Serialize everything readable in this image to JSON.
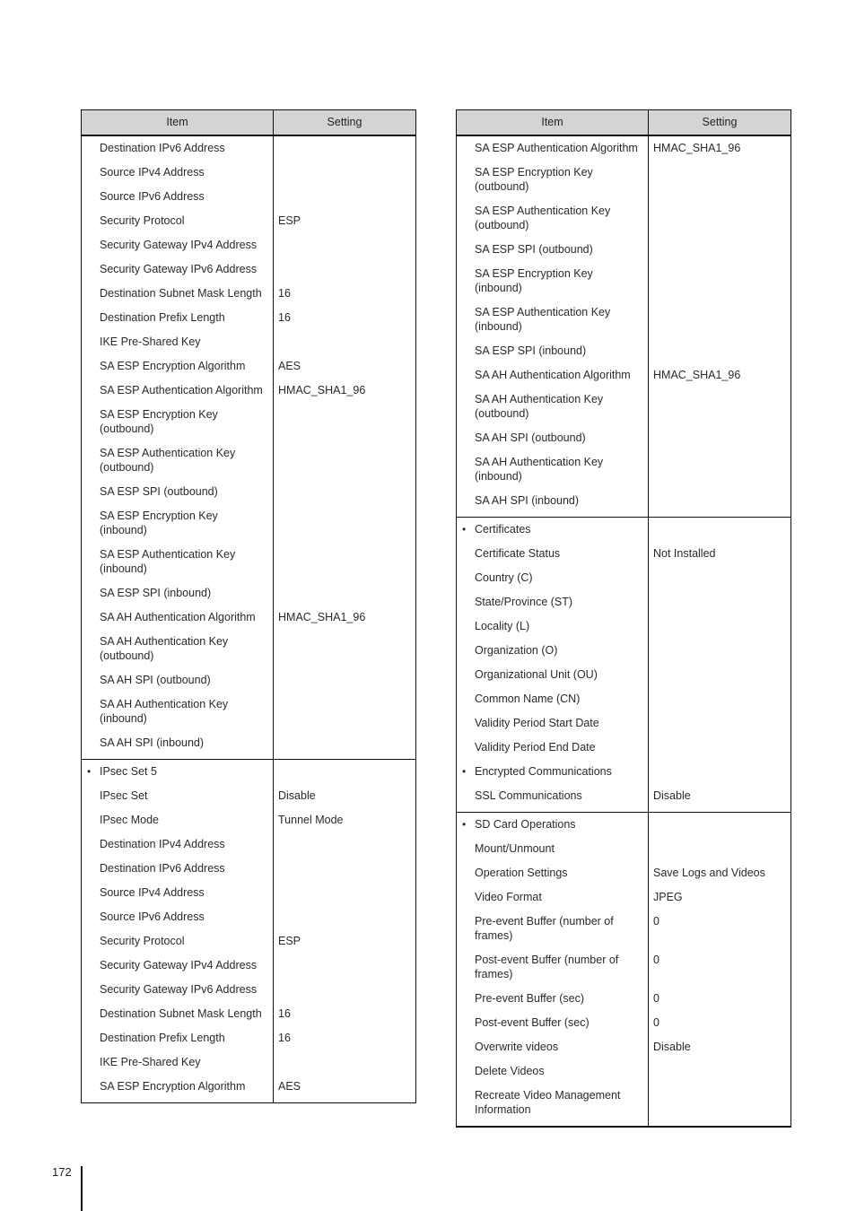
{
  "page": {
    "number": "172"
  },
  "headers": {
    "item": "Item",
    "setting": "Setting"
  },
  "left_table": {
    "groups": [
      {
        "rows": [
          {
            "item": "Destination IPv6 Address",
            "setting": ""
          },
          {
            "item": "Source IPv4 Address",
            "setting": ""
          },
          {
            "item": "Source IPv6 Address",
            "setting": ""
          },
          {
            "item": "Security Protocol",
            "setting": "ESP"
          },
          {
            "item": "Security Gateway IPv4 Address",
            "setting": ""
          },
          {
            "item": "Security Gateway IPv6 Address",
            "setting": ""
          },
          {
            "item": "Destination Subnet Mask Length",
            "setting": "16"
          },
          {
            "item": "Destination Prefix Length",
            "setting": "16"
          },
          {
            "item": "IKE Pre-Shared Key",
            "setting": ""
          },
          {
            "item": "SA ESP Encryption Algorithm",
            "setting": "AES"
          },
          {
            "item": "SA ESP Authentication Algorithm",
            "setting": "HMAC_SHA1_96"
          },
          {
            "item": "SA ESP Encryption Key (outbound)",
            "setting": ""
          },
          {
            "item": "SA ESP Authentication Key (outbound)",
            "setting": ""
          },
          {
            "item": "SA ESP SPI (outbound)",
            "setting": ""
          },
          {
            "item": "SA ESP Encryption Key (inbound)",
            "setting": ""
          },
          {
            "item": "SA ESP Authentication Key (inbound)",
            "setting": ""
          },
          {
            "item": "SA ESP SPI (inbound)",
            "setting": ""
          },
          {
            "item": "SA AH Authentication Algorithm",
            "setting": "HMAC_SHA1_96"
          },
          {
            "item": "SA AH Authentication Key (outbound)",
            "setting": ""
          },
          {
            "item": "SA AH SPI (outbound)",
            "setting": ""
          },
          {
            "item": "SA AH Authentication Key (inbound)",
            "setting": ""
          },
          {
            "item": "SA AH SPI (inbound)",
            "setting": ""
          }
        ]
      },
      {
        "rows": [
          {
            "item": "IPsec Set 5",
            "setting": "",
            "bullet": true
          },
          {
            "item": "IPsec Set",
            "setting": "Disable"
          },
          {
            "item": "IPsec Mode",
            "setting": "Tunnel Mode"
          },
          {
            "item": "Destination IPv4 Address",
            "setting": ""
          },
          {
            "item": "Destination IPv6 Address",
            "setting": ""
          },
          {
            "item": "Source IPv4 Address",
            "setting": ""
          },
          {
            "item": "Source IPv6 Address",
            "setting": ""
          },
          {
            "item": "Security Protocol",
            "setting": "ESP"
          },
          {
            "item": "Security Gateway IPv4 Address",
            "setting": ""
          },
          {
            "item": "Security Gateway IPv6 Address",
            "setting": ""
          },
          {
            "item": "Destination Subnet Mask Length",
            "setting": "16"
          },
          {
            "item": "Destination Prefix Length",
            "setting": "16"
          },
          {
            "item": "IKE Pre-Shared Key",
            "setting": ""
          },
          {
            "item": "SA ESP Encryption Algorithm",
            "setting": "AES"
          }
        ]
      }
    ]
  },
  "right_table": {
    "groups": [
      {
        "rows": [
          {
            "item": "SA ESP Authentication Algorithm",
            "setting": "HMAC_SHA1_96"
          },
          {
            "item": "SA ESP Encryption Key (outbound)",
            "setting": ""
          },
          {
            "item": "SA ESP Authentication Key (outbound)",
            "setting": ""
          },
          {
            "item": "SA ESP SPI (outbound)",
            "setting": ""
          },
          {
            "item": "SA ESP Encryption Key (inbound)",
            "setting": ""
          },
          {
            "item": "SA ESP Authentication Key (inbound)",
            "setting": ""
          },
          {
            "item": "SA ESP SPI (inbound)",
            "setting": ""
          },
          {
            "item": "SA AH Authentication Algorithm",
            "setting": "HMAC_SHA1_96"
          },
          {
            "item": "SA AH Authentication Key (outbound)",
            "setting": ""
          },
          {
            "item": "SA AH SPI (outbound)",
            "setting": ""
          },
          {
            "item": "SA AH Authentication Key (inbound)",
            "setting": ""
          },
          {
            "item": "SA AH SPI (inbound)",
            "setting": ""
          }
        ]
      },
      {
        "rows": [
          {
            "item": "Certificates",
            "setting": "",
            "bullet": true
          },
          {
            "item": "Certificate Status",
            "setting": "Not Installed"
          },
          {
            "item": "Country (C)",
            "setting": ""
          },
          {
            "item": "State/Province (ST)",
            "setting": ""
          },
          {
            "item": "Locality (L)",
            "setting": ""
          },
          {
            "item": "Organization (O)",
            "setting": ""
          },
          {
            "item": "Organizational Unit (OU)",
            "setting": ""
          },
          {
            "item": "Common Name (CN)",
            "setting": ""
          },
          {
            "item": "Validity Period Start Date",
            "setting": ""
          },
          {
            "item": "Validity Period End Date",
            "setting": ""
          },
          {
            "item": "Encrypted Communications",
            "setting": "",
            "bullet": true
          },
          {
            "item": "SSL Communications",
            "setting": "Disable"
          }
        ]
      },
      {
        "rows": [
          {
            "item": "SD Card Operations",
            "setting": "",
            "bullet": true
          },
          {
            "item": "Mount/Unmount",
            "setting": ""
          },
          {
            "item": "Operation Settings",
            "setting": "Save Logs and Videos"
          },
          {
            "item": "Video Format",
            "setting": "JPEG"
          },
          {
            "item": "Pre-event Buffer (number of frames)",
            "setting": "0"
          },
          {
            "item": "Post-event Buffer (number of frames)",
            "setting": "0"
          },
          {
            "item": "Pre-event Buffer (sec)",
            "setting": "0"
          },
          {
            "item": "Post-event Buffer (sec)",
            "setting": "0"
          },
          {
            "item": "Overwrite videos",
            "setting": "Disable"
          },
          {
            "item": "Delete Videos",
            "setting": ""
          },
          {
            "item": "Recreate Video Management Information",
            "setting": ""
          }
        ]
      }
    ]
  }
}
